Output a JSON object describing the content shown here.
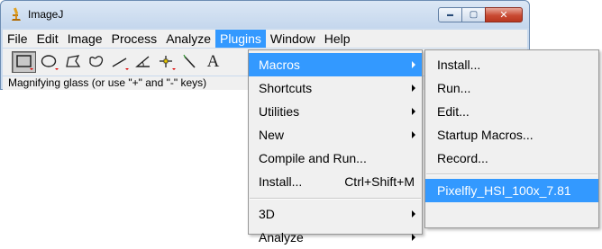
{
  "window": {
    "title": "ImageJ",
    "caption_buttons": {
      "minimize": "▬",
      "maximize": "▢",
      "close": "✕"
    }
  },
  "menubar": {
    "items": [
      {
        "label": "File"
      },
      {
        "label": "Edit"
      },
      {
        "label": "Image"
      },
      {
        "label": "Process"
      },
      {
        "label": "Analyze"
      },
      {
        "label": "Plugins",
        "active": true
      },
      {
        "label": "Window"
      },
      {
        "label": "Help"
      }
    ]
  },
  "toolbar": {
    "tools": [
      {
        "icon": "rectangle-tool-icon",
        "selected": true
      },
      {
        "icon": "oval-tool-icon"
      },
      {
        "icon": "polygon-tool-icon"
      },
      {
        "icon": "freehand-tool-icon"
      },
      {
        "icon": "line-tool-icon"
      },
      {
        "icon": "angle-tool-icon"
      },
      {
        "icon": "point-tool-icon"
      },
      {
        "icon": "wand-tool-icon"
      },
      {
        "icon": "text-tool-icon",
        "text": "A"
      }
    ]
  },
  "status": {
    "text": "Magnifying glass (or use \"+\" and \"-\" keys)"
  },
  "plugins_menu": {
    "items": [
      {
        "label": "Macros",
        "submenu": true,
        "active": true
      },
      {
        "label": "Shortcuts",
        "submenu": true
      },
      {
        "label": "Utilities",
        "submenu": true
      },
      {
        "label": "New",
        "submenu": true
      },
      {
        "label": "Compile and Run..."
      },
      {
        "label": "Install...",
        "shortcut": "Ctrl+Shift+M"
      },
      {
        "separator": true
      },
      {
        "label": "3D",
        "submenu": true
      },
      {
        "label": "Analyze",
        "submenu": true
      }
    ]
  },
  "macros_submenu": {
    "items": [
      {
        "label": "Install..."
      },
      {
        "label": "Run..."
      },
      {
        "label": "Edit..."
      },
      {
        "label": "Startup Macros..."
      },
      {
        "label": "Record..."
      },
      {
        "separator": true
      },
      {
        "label": "Pixelfly_HSI_100x_7.81",
        "active": true
      }
    ]
  },
  "colors": {
    "highlight": "#3399ff",
    "menu_bg": "#f0f0f0",
    "title_bg": "#c9daee",
    "close_button": "#c94a33"
  }
}
